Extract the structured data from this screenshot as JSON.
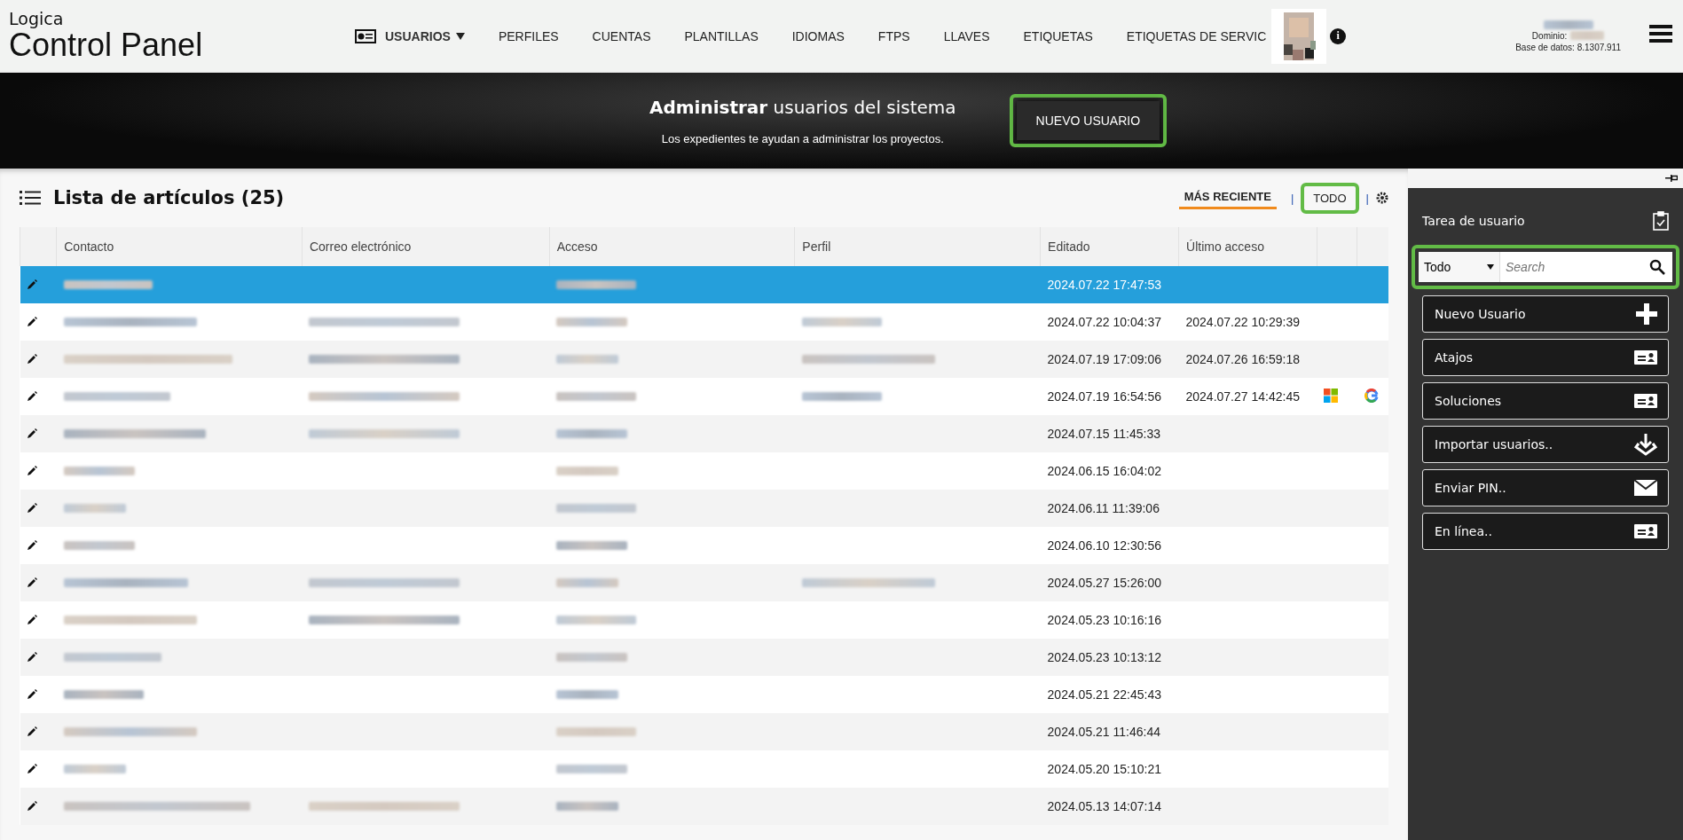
{
  "brand": {
    "small": "Logica",
    "large": "Control Panel"
  },
  "nav": [
    {
      "label": "USUARIOS",
      "selected": true,
      "dropdown": true
    },
    {
      "label": "PERFILES",
      "selected": false,
      "dropdown": false
    },
    {
      "label": "CUENTAS",
      "selected": false,
      "dropdown": false
    },
    {
      "label": "PLANTILLAS",
      "selected": false,
      "dropdown": false
    },
    {
      "label": "IDIOMAS",
      "selected": false,
      "dropdown": false
    },
    {
      "label": "FTPS",
      "selected": false,
      "dropdown": false
    },
    {
      "label": "LLAVES",
      "selected": false,
      "dropdown": false
    },
    {
      "label": "ETIQUETAS",
      "selected": false,
      "dropdown": false
    },
    {
      "label": "ETIQUETAS DE SERVIC",
      "selected": false,
      "dropdown": false
    }
  ],
  "info_icon": "i",
  "account": {
    "domain_label": "Dominio:",
    "database_label": "Base de datos: 8.1307.911"
  },
  "banner": {
    "title_bold": "Administrar",
    "title_rest": "usuarios del sistema",
    "subtitle": "Los expedientes te ayudan a administrar los proyectos.",
    "button": {
      "label": "NUEVO USUARIO",
      "highlighted": true
    }
  },
  "list": {
    "title": "Lista de artículos (25)",
    "filters": [
      {
        "label": "MÁS RECIENTE",
        "selected": true
      },
      {
        "label": "TODO",
        "selected": false,
        "highlighted": true
      }
    ],
    "separator": "|",
    "columns": [
      "Contacto",
      "Correo electrónico",
      "Acceso",
      "Perfil",
      "Editado",
      "Último acceso"
    ],
    "rows": [
      {
        "selected": true,
        "contact_hidden": true,
        "email_hidden": false,
        "access_hidden": true,
        "profile_hidden": false,
        "edited": "2024.07.22 17:47:53"
      },
      {
        "selected": false,
        "contact_hidden": true,
        "email_hidden": true,
        "access_hidden": true,
        "profile_hidden": true,
        "edited": "2024.07.22 10:04:37",
        "last_access": "2024.07.22 10:29:39"
      },
      {
        "selected": false,
        "contact_hidden": true,
        "email_hidden": true,
        "access_hidden": true,
        "profile_hidden": true,
        "edited": "2024.07.19 17:09:06",
        "last_access": "2024.07.26 16:59:18"
      },
      {
        "selected": false,
        "contact_hidden": true,
        "email_hidden": true,
        "access_hidden": true,
        "profile_hidden": true,
        "edited": "2024.07.19 16:54:56",
        "last_access": "2024.07.27 14:42:45",
        "microsoft": true,
        "google": true
      },
      {
        "selected": false,
        "contact_hidden": true,
        "email_hidden": true,
        "access_hidden": true,
        "profile_hidden": false,
        "edited": "2024.07.15 11:45:33"
      },
      {
        "selected": false,
        "contact_hidden": true,
        "email_hidden": false,
        "access_hidden": true,
        "profile_hidden": false,
        "edited": "2024.06.15 16:04:02"
      },
      {
        "selected": false,
        "contact_hidden": true,
        "email_hidden": false,
        "access_hidden": true,
        "profile_hidden": false,
        "edited": "2024.06.11 11:39:06"
      },
      {
        "selected": false,
        "contact_hidden": true,
        "email_hidden": false,
        "access_hidden": true,
        "profile_hidden": false,
        "edited": "2024.06.10 12:30:56"
      },
      {
        "selected": false,
        "contact_hidden": true,
        "email_hidden": true,
        "access_hidden": true,
        "profile_hidden": true,
        "edited": "2024.05.27 15:26:00"
      },
      {
        "selected": false,
        "contact_hidden": true,
        "email_hidden": true,
        "access_hidden": true,
        "profile_hidden": false,
        "edited": "2024.05.23 10:16:16"
      },
      {
        "selected": false,
        "contact_hidden": true,
        "email_hidden": false,
        "access_hidden": true,
        "profile_hidden": false,
        "edited": "2024.05.23 10:13:12"
      },
      {
        "selected": false,
        "contact_hidden": true,
        "email_hidden": false,
        "access_hidden": true,
        "profile_hidden": false,
        "edited": "2024.05.21 22:45:43"
      },
      {
        "selected": false,
        "contact_hidden": true,
        "email_hidden": false,
        "access_hidden": true,
        "profile_hidden": false,
        "edited": "2024.05.21 11:46:44"
      },
      {
        "selected": false,
        "contact_hidden": true,
        "email_hidden": false,
        "access_hidden": true,
        "profile_hidden": false,
        "edited": "2024.05.20 15:10:21"
      },
      {
        "selected": false,
        "contact_hidden": true,
        "email_hidden": true,
        "access_hidden": true,
        "profile_hidden": false,
        "edited": "2024.05.13 14:07:14"
      }
    ]
  },
  "sidebar": {
    "title": "Tarea de usuario",
    "search": {
      "scope": "Todo",
      "placeholder": "Search",
      "highlighted": true
    },
    "actions": [
      {
        "label": "Nuevo Usuario",
        "kind": "plus"
      },
      {
        "label": "Atajos",
        "kind": "card"
      },
      {
        "label": "Soluciones",
        "kind": "card"
      },
      {
        "label": "Importar usuarios..",
        "kind": "download"
      },
      {
        "label": "Enviar PIN..",
        "kind": "mail"
      },
      {
        "label": "En línea..",
        "kind": "card"
      }
    ]
  }
}
